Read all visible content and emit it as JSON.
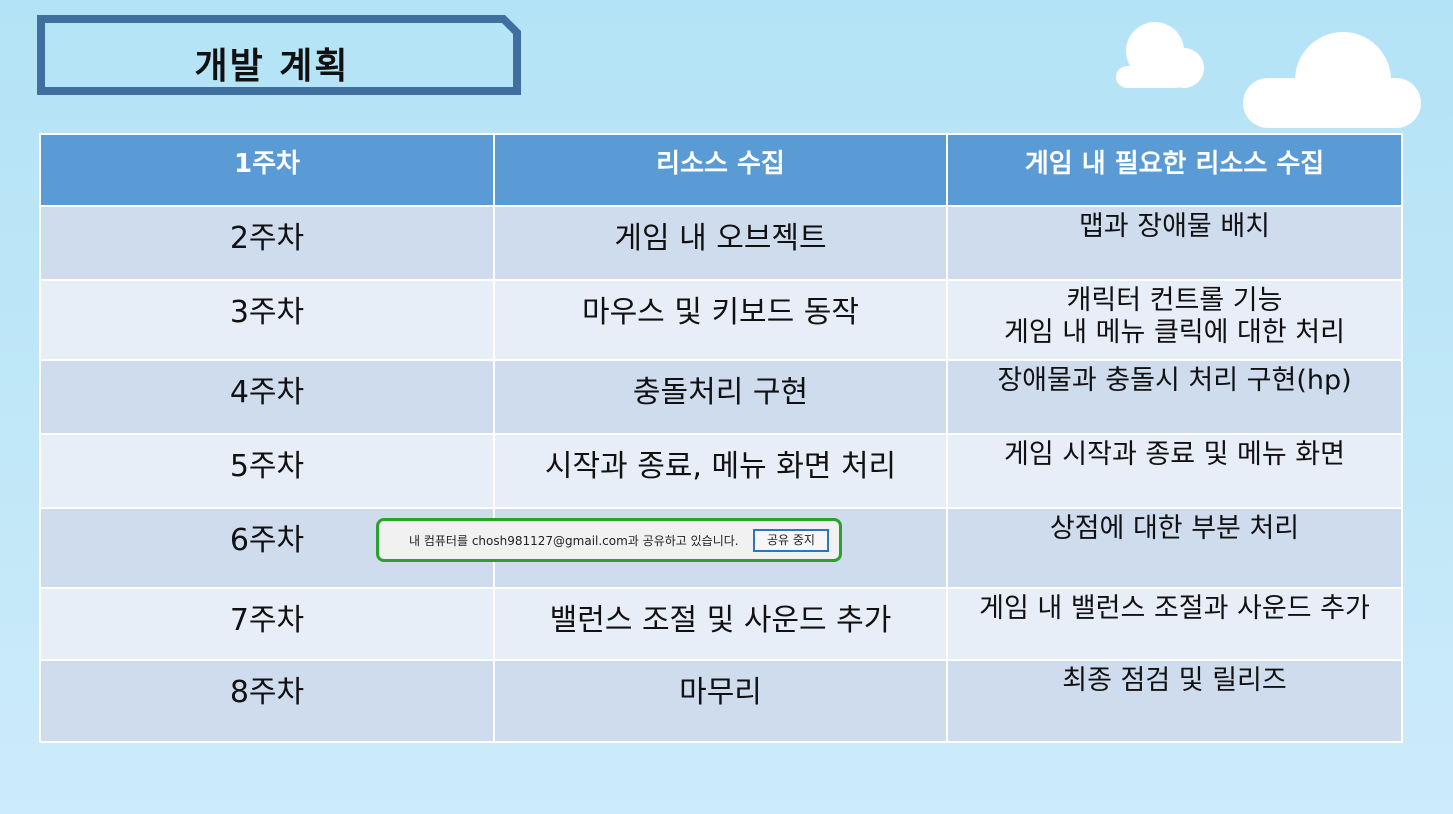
{
  "slide": {
    "title": "개발 계획"
  },
  "table": {
    "header": [
      "1주차",
      "리소스 수집",
      "게임 내 필요한 리소스 수집"
    ],
    "rows": [
      {
        "week": "2주차",
        "task": "게임 내 오브젝트",
        "detail": [
          "맵과 장애물 배치"
        ]
      },
      {
        "week": "3주차",
        "task": "마우스 및 키보드 동작",
        "detail": [
          "캐릭터 컨트롤 기능",
          "게임 내 메뉴 클릭에 대한 처리"
        ]
      },
      {
        "week": "4주차",
        "task": "충돌처리 구현",
        "detail": [
          "장애물과 충돌시 처리 구현(hp)"
        ]
      },
      {
        "week": "5주차",
        "task": "시작과 종료, 메뉴 화면 처리",
        "detail": [
          "게임 시작과 종료 및 메뉴 화면"
        ]
      },
      {
        "week": "6주차",
        "task": "",
        "detail": [
          "상점에 대한 부분 처리"
        ]
      },
      {
        "week": "7주차",
        "task": "밸런스 조절 및 사운드 추가",
        "detail": [
          "게임 내 밸런스 조절과 사운드 추가"
        ]
      },
      {
        "week": "8주차",
        "task": "마무리",
        "detail": [
          "최종 점검 및 릴리즈"
        ]
      }
    ]
  },
  "share_bar": {
    "message": "내 컴퓨터를 chosh981127@gmail.com과 공유하고 있습니다.",
    "stop_button": "공유 중지"
  },
  "colors": {
    "header": "#5b9bd5",
    "row_dark": "#cfdcee",
    "row_light": "#e8eef7",
    "title_border": "#3f6f9f",
    "share_border": "#2aa12a"
  }
}
